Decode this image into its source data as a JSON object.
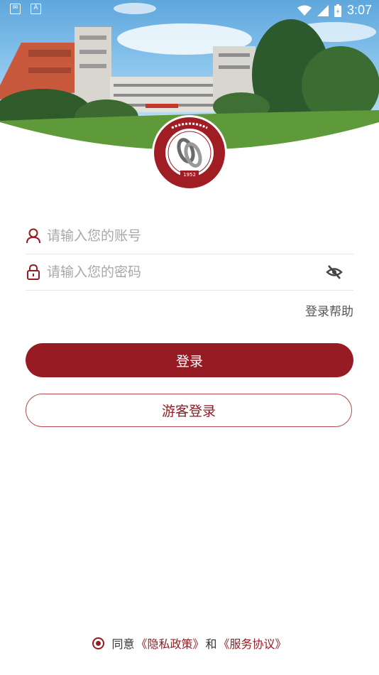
{
  "status_bar": {
    "time": "3:07"
  },
  "login": {
    "account_placeholder": "请输入您的账号",
    "password_placeholder": "请输入您的密码",
    "help_label": "登录帮助",
    "login_button": "登录",
    "guest_button": "游客登录"
  },
  "agreement": {
    "prefix": "同意",
    "privacy_link": "《隐私政策》",
    "connector": "和",
    "service_link": "《服务协议》"
  },
  "logo": {
    "year": "1952"
  },
  "colors": {
    "brand": "#961b22",
    "placeholder": "#a8a8a8",
    "divider": "#e6e6e6"
  },
  "icons": [
    "user-icon",
    "lock-icon",
    "eye-off-icon",
    "wifi-icon",
    "signal-icon",
    "battery-icon"
  ]
}
